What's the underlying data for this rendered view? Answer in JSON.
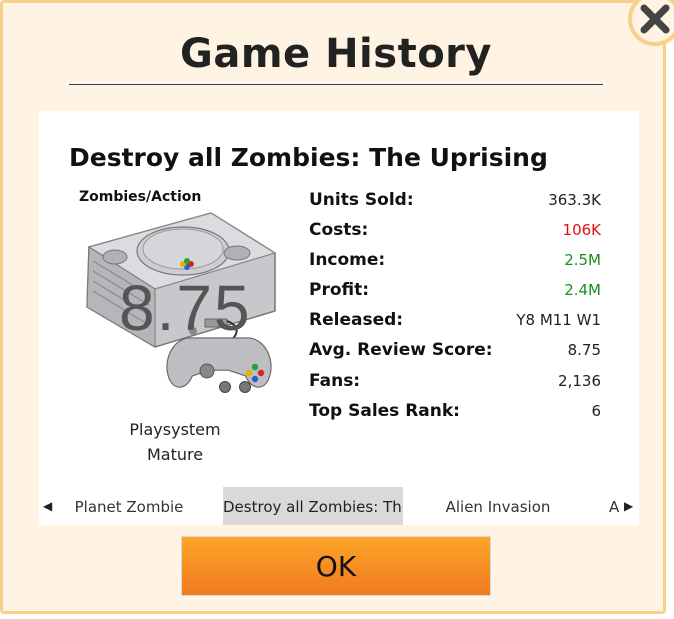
{
  "dialog": {
    "title": "Game History",
    "ok_label": "OK",
    "colors": {
      "background": "#fff4e3",
      "border": "#f7d089",
      "ok_button": "#f58b22"
    }
  },
  "game": {
    "title": "Destroy all Zombies: The Uprising",
    "genre": "Zombies/Action",
    "score_overlay": "8.75",
    "platform": "Playsystem",
    "rating": "Mature",
    "console_icon": "playsystem-console-icon"
  },
  "stats": [
    {
      "label": "Units Sold:",
      "value": "363.3K",
      "color": "#222222"
    },
    {
      "label": "Costs:",
      "value": "106K",
      "color": "#e01010"
    },
    {
      "label": "Income:",
      "value": "2.5M",
      "color": "#1a8f1a"
    },
    {
      "label": "Profit:",
      "value": "2.4M",
      "color": "#1a8f1a"
    },
    {
      "label": "Released:",
      "value": "Y8 M11 W1",
      "color": "#222222"
    },
    {
      "label": "Avg. Review Score:",
      "value": "8.75",
      "color": "#222222"
    },
    {
      "label": "Fans:",
      "value": "2,136",
      "color": "#222222"
    },
    {
      "label": "Top Sales Rank:",
      "value": "6",
      "color": "#222222"
    }
  ],
  "carousel": {
    "items": [
      "Planet Zombie",
      "Destroy all Zombies: Th...",
      "Alien Invasion",
      "A Ba"
    ],
    "active_index": 1
  }
}
